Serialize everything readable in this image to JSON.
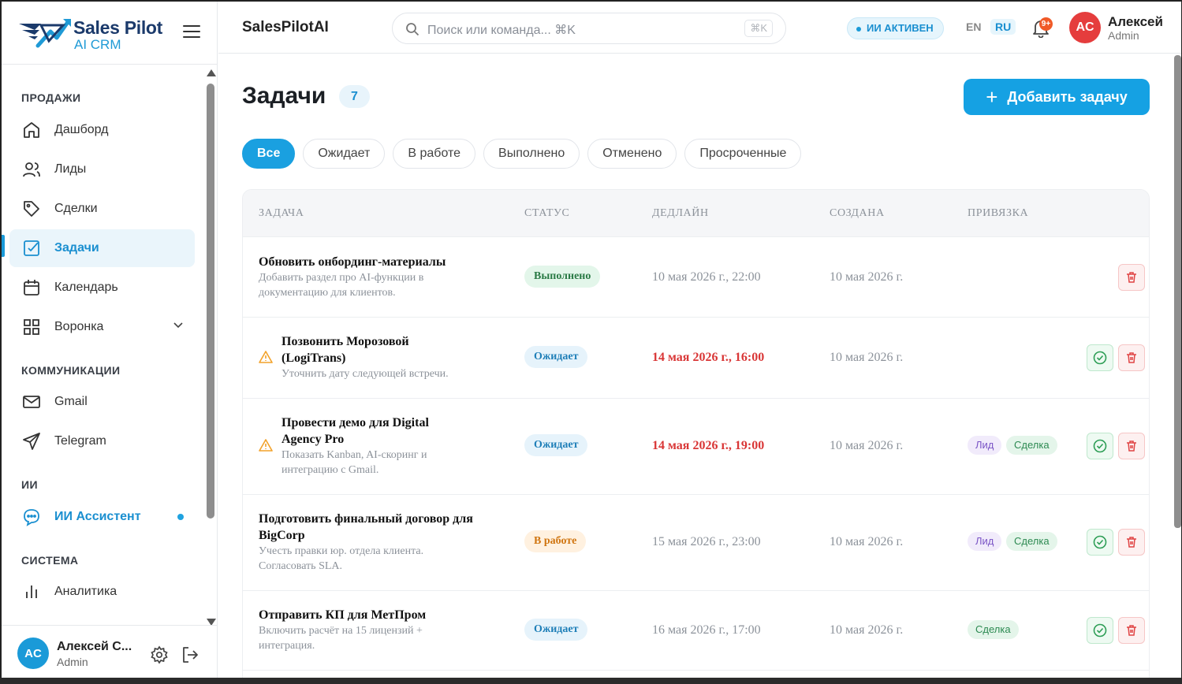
{
  "brand": {
    "name": "Sales Pilot",
    "sub": "AI CRM"
  },
  "sidebar": {
    "sections": {
      "sales": "ПРОДАЖИ",
      "comms": "КОММУНИКАЦИИ",
      "ai": "ИИ",
      "system": "СИСТЕМА"
    },
    "items": [
      {
        "label": "Дашборд",
        "icon": "home-icon"
      },
      {
        "label": "Лиды",
        "icon": "users-icon"
      },
      {
        "label": "Сделки",
        "icon": "tag-icon"
      },
      {
        "label": "Задачи",
        "icon": "checkbox-icon",
        "active": true
      },
      {
        "label": "Календарь",
        "icon": "calendar-icon"
      },
      {
        "label": "Воронка",
        "icon": "grid-icon"
      },
      {
        "label": "Gmail",
        "icon": "mail-icon"
      },
      {
        "label": "Telegram",
        "icon": "send-icon"
      },
      {
        "label": "ИИ Ассистент",
        "icon": "chat-bot-icon"
      },
      {
        "label": "Аналитика",
        "icon": "bar-chart-icon"
      }
    ],
    "user": {
      "initials": "AC",
      "name": "Алексей С...",
      "role": "Admin"
    }
  },
  "topbar": {
    "title": "SalesPilotAI",
    "search": {
      "placeholder": "Поиск или команда... ⌘K",
      "shortcut": "⌘K"
    },
    "ai_status": "ИИ АКТИВЕН",
    "lang_en": "EN",
    "lang_ru": "RU",
    "notifications": "9+",
    "user": {
      "initials": "AC",
      "name": "Алексей",
      "role": "Admin"
    }
  },
  "page": {
    "title": "Задачи",
    "count": "7",
    "add_button": "Добавить задачу"
  },
  "filters": [
    "Все",
    "Ожидает",
    "В работе",
    "Выполнено",
    "Отменено",
    "Просроченные"
  ],
  "table": {
    "headers": [
      "ЗАДАЧА",
      "СТАТУС",
      "ДЕДЛАЙН",
      "СОЗДАНА",
      "ПРИВЯЗКА"
    ],
    "rows": [
      {
        "title": "Обновить онбординг-материалы",
        "desc": "Добавить раздел про AI-функции в документацию для клиентов.",
        "status": "Выполнено",
        "deadline": "10 мая 2026 г., 22:00",
        "created": "10 мая 2026 г.",
        "overdue": false,
        "tags": []
      },
      {
        "title": "Позвонить Морозовой (LogiTrans)",
        "desc": "Уточнить дату следующей встречи.",
        "status": "Ожидает",
        "deadline": "14 мая 2026 г., 16:00",
        "created": "10 мая 2026 г.",
        "overdue": true,
        "tags": []
      },
      {
        "title": "Провести демо для Digital Agency Pro",
        "desc": "Показать Kanban, AI-скоринг и интеграцию с Gmail.",
        "status": "Ожидает",
        "deadline": "14 мая 2026 г., 19:00",
        "created": "10 мая 2026 г.",
        "overdue": true,
        "tags": [
          "Лид",
          "Сделка"
        ]
      },
      {
        "title": "Подготовить финальный договор для BigCorp",
        "desc": "Учесть правки юр. отдела клиента. Согласовать SLA.",
        "status": "В работе",
        "deadline": "15 мая 2026 г., 23:00",
        "created": "10 мая 2026 г.",
        "overdue": false,
        "tags": [
          "Лид",
          "Сделка"
        ]
      },
      {
        "title": "Отправить КП для МетПром",
        "desc": "Включить расчёт на 15 лицензий + интеграция.",
        "status": "Ожидает",
        "deadline": "16 мая 2026 г., 17:00",
        "created": "10 мая 2026 г.",
        "overdue": false,
        "tags": [
          "Сделка"
        ]
      }
    ]
  },
  "colors": {
    "accent": "#15a1e3",
    "danger": "#d93636",
    "brand_dark": "#1b3a6b"
  }
}
